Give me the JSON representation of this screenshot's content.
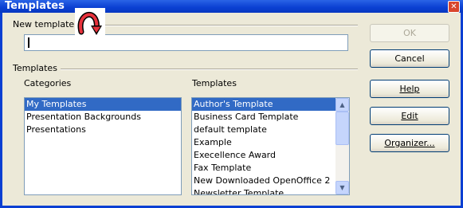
{
  "window": {
    "title": "Templates",
    "close_glyph": "✕"
  },
  "new_template": {
    "label": "New template",
    "value": ""
  },
  "templates_group": {
    "label": "Templates"
  },
  "categories": {
    "header": "Categories",
    "items": [
      {
        "label": "My Templates",
        "selected": true
      },
      {
        "label": "Presentation Backgrounds",
        "selected": false
      },
      {
        "label": "Presentations",
        "selected": false
      }
    ]
  },
  "templates": {
    "header": "Templates",
    "items": [
      {
        "label": "Author's Template",
        "selected": true
      },
      {
        "label": "Business Card Template",
        "selected": false
      },
      {
        "label": "default template",
        "selected": false
      },
      {
        "label": "Example",
        "selected": false
      },
      {
        "label": "Execellence Award",
        "selected": false
      },
      {
        "label": "Fax Template",
        "selected": false
      },
      {
        "label": "New Downloaded OpenOffice 2",
        "selected": false
      },
      {
        "label": "Newsletter Template",
        "selected": false
      }
    ]
  },
  "buttons": {
    "ok": "OK",
    "cancel": "Cancel",
    "help": "Help",
    "edit": "Edit",
    "organizer": "Organizer..."
  },
  "colors": {
    "title_bar": "#0a3fd2",
    "selection": "#316ac5",
    "cursor_icon": "#e8323c"
  },
  "icons": {
    "cursor": "curved-arrow-cursor-icon",
    "scroll_up": "scroll-up-arrow-icon",
    "scroll_down": "scroll-down-arrow-icon"
  }
}
